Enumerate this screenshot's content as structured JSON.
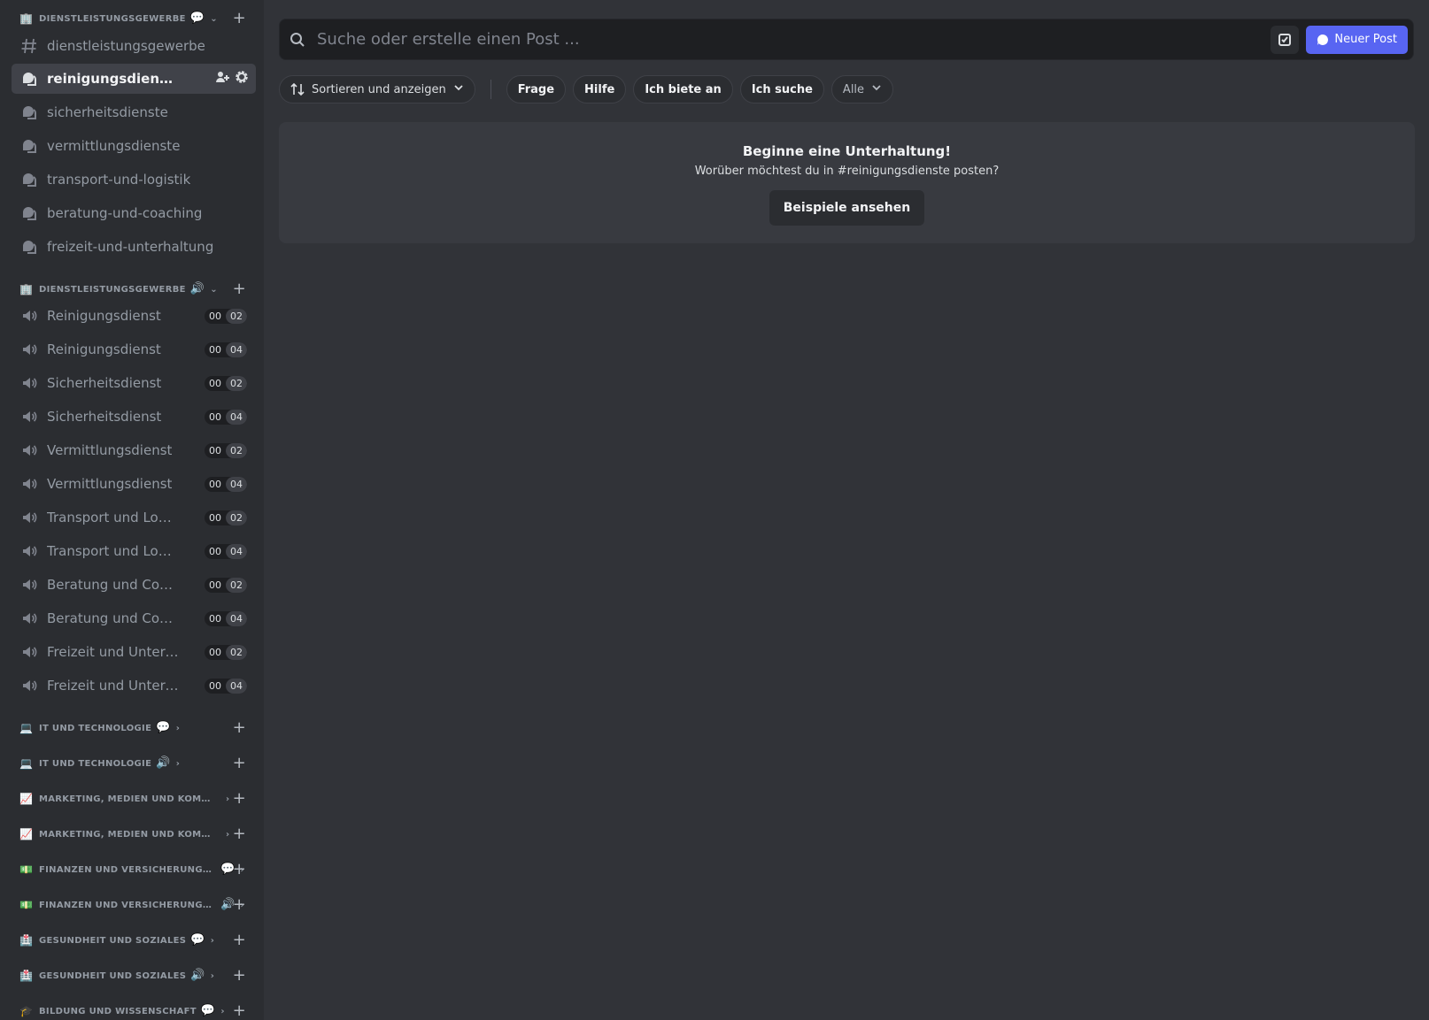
{
  "sidebar": {
    "cat1": {
      "emoji": "🏢",
      "label": "DIENSTLEISTUNGSGEWERBE",
      "suffix": "💬"
    },
    "text_channels": [
      {
        "label": "dienstleistungsgewerbe"
      },
      {
        "label": "reinigungsdienste"
      },
      {
        "label": "sicherheitsdienste"
      },
      {
        "label": "vermittlungsdienste"
      },
      {
        "label": "transport-und-logistik"
      },
      {
        "label": "beratung-und-coaching"
      },
      {
        "label": "freizeit-und-unterhaltung"
      }
    ],
    "cat2": {
      "emoji": "🏢",
      "label": "DIENSTLEISTUNGSGEWERBE",
      "suffix": "🔊"
    },
    "voice_channels": [
      {
        "label": "Reinigungsdienst",
        "count": "00",
        "limit": "02"
      },
      {
        "label": "Reinigungsdienst",
        "count": "00",
        "limit": "04"
      },
      {
        "label": "Sicherheitsdienst",
        "count": "00",
        "limit": "02"
      },
      {
        "label": "Sicherheitsdienst",
        "count": "00",
        "limit": "04"
      },
      {
        "label": "Vermittlungsdienst",
        "count": "00",
        "limit": "02"
      },
      {
        "label": "Vermittlungsdienst",
        "count": "00",
        "limit": "04"
      },
      {
        "label": "Transport und Logis...",
        "count": "00",
        "limit": "02"
      },
      {
        "label": "Transport und Logis...",
        "count": "00",
        "limit": "04"
      },
      {
        "label": "Beratung und Coach...",
        "count": "00",
        "limit": "02"
      },
      {
        "label": "Beratung und Coach...",
        "count": "00",
        "limit": "04"
      },
      {
        "label": "Freizeit und Unterha...",
        "count": "00",
        "limit": "02"
      },
      {
        "label": "Freizeit und Unterha...",
        "count": "00",
        "limit": "04"
      }
    ],
    "collapsed_categories": [
      {
        "emoji": "💻",
        "label": "IT UND TECHNOLOGIE",
        "suffix": "💬"
      },
      {
        "emoji": "💻",
        "label": "IT UND TECHNOLOGIE",
        "suffix": "🔊"
      },
      {
        "emoji": "📈",
        "label": "MARKETING, MEDIEN UND KOMMUNI...",
        "suffix": ""
      },
      {
        "emoji": "📈",
        "label": "MARKETING, MEDIEN UND KOMMUNI...",
        "suffix": ""
      },
      {
        "emoji": "💵",
        "label": "FINANZEN UND VERSICHERUNGEN",
        "suffix": "💬"
      },
      {
        "emoji": "💵",
        "label": "FINANZEN UND VERSICHERUNGEN",
        "suffix": "🔊"
      },
      {
        "emoji": "🏥",
        "label": "GESUNDHEIT UND SOZIALES",
        "suffix": "💬"
      },
      {
        "emoji": "🏥",
        "label": "GESUNDHEIT UND SOZIALES",
        "suffix": "🔊"
      },
      {
        "emoji": "🎓",
        "label": "BILDUNG UND WISSENSCHAFT",
        "suffix": "💬"
      }
    ]
  },
  "main": {
    "search_placeholder": "Suche oder erstelle einen Post ...",
    "new_post_label": "Neuer Post",
    "sort_label": "Sortieren und anzeigen",
    "tags": [
      "Frage",
      "Hilfe",
      "Ich biete an",
      "Ich suche"
    ],
    "all_label": "Alle",
    "empty_title": "Beginne eine Unterhaltung!",
    "empty_subtitle": "Worüber möchtest du in #reinigungsdienste posten?",
    "examples_label": "Beispiele ansehen"
  },
  "colors": {
    "accent": "#5865f2",
    "background": "#313338",
    "sidebar": "#2b2d31"
  }
}
